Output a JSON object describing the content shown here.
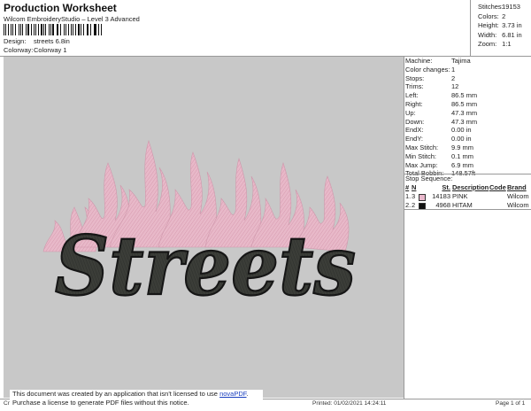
{
  "header": {
    "title": "Production Worksheet",
    "subtitle": "Wilcom EmbroideryStudio – Level 3 Advanced",
    "design_label": "Design:",
    "design_value": "streets 6.8in",
    "colorway_label": "Colorway:",
    "colorway_value": "Colorway 1"
  },
  "stats": [
    {
      "label": "Stitches:",
      "value": "19153"
    },
    {
      "label": "Colors:",
      "value": "2"
    },
    {
      "label": "Height:",
      "value": "3.73 in"
    },
    {
      "label": "Width:",
      "value": "6.81 in"
    },
    {
      "label": "Zoom:",
      "value": "1:1"
    }
  ],
  "machine_info": [
    {
      "label": "Machine:",
      "value": "Tajima"
    },
    {
      "label": "Color changes:",
      "value": "1"
    },
    {
      "label": "Stops:",
      "value": "2"
    },
    {
      "label": "Trims:",
      "value": "12"
    },
    {
      "label": "Left:",
      "value": "86.5 mm"
    },
    {
      "label": "Right:",
      "value": "86.5 mm"
    },
    {
      "label": "Up:",
      "value": "47.3 mm"
    },
    {
      "label": "Down:",
      "value": "47.3 mm"
    },
    {
      "label": "EndX:",
      "value": "0.00 in"
    },
    {
      "label": "EndY:",
      "value": "0.00 in"
    },
    {
      "label": "Max Stitch:",
      "value": "9.9 mm"
    },
    {
      "label": "Min Stitch:",
      "value": "0.1 mm"
    },
    {
      "label": "Max Jump:",
      "value": "6.9 mm"
    },
    {
      "label": "Total Bobbin:",
      "value": "148.57ft"
    }
  ],
  "stop_sequence": {
    "title": "Stop Sequence:",
    "headers": [
      "#",
      "N",
      "St.",
      "Description",
      "Code",
      "Brand"
    ],
    "rows": [
      {
        "num": "1.",
        "n": "3",
        "color": "#e9b8cc",
        "st": "14183",
        "description": "PINK",
        "code": "",
        "brand": "Wilcom"
      },
      {
        "num": "2.",
        "n": "2",
        "color": "#111111",
        "st": "4968",
        "description": "HITAM",
        "code": "",
        "brand": "Wilcom"
      }
    ]
  },
  "design_text": "Streets",
  "colors": {
    "flame": "#e8b9c9",
    "flame_dark": "#d79bb0",
    "letters": "#3b3d38",
    "outline": "#161616",
    "canvas": "#c8c8c8"
  },
  "notice": {
    "line1_prefix": "This document was created by an application that isn't licensed to use ",
    "link": "novaPDF",
    "line1_suffix": ".",
    "line2": "Purchase a license to generate PDF files without this notice."
  },
  "footer": {
    "left": "Cr",
    "printed": "Printed: 01/02/2021 14:24:11",
    "page": "Page 1 of 1"
  }
}
